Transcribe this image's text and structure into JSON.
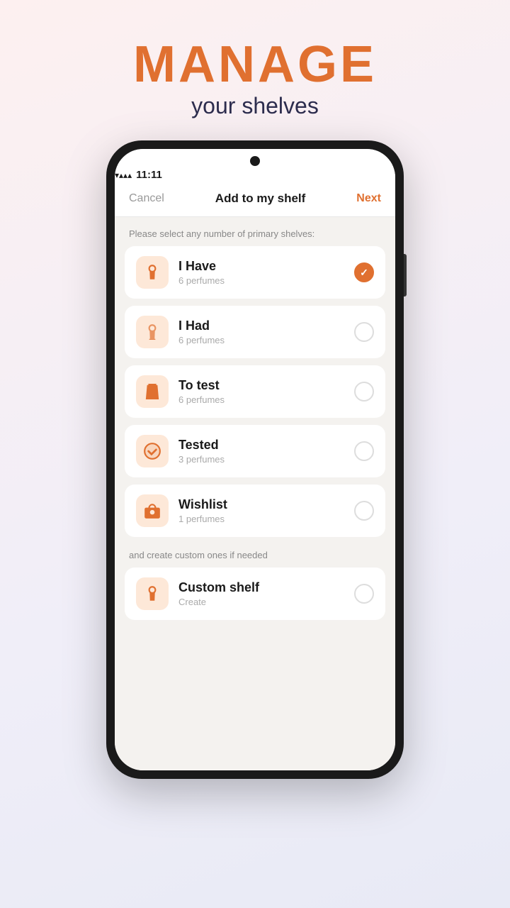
{
  "header": {
    "manage_label": "MANAGE",
    "subtitle_label": "your shelves"
  },
  "status_bar": {
    "time": "11:11"
  },
  "nav": {
    "cancel_label": "Cancel",
    "title_label": "Add to my shelf",
    "next_label": "Next"
  },
  "primary_section_label": "Please select any number of primary shelves:",
  "secondary_section_label": "and create custom ones if needed",
  "shelves": [
    {
      "id": "i-have",
      "name": "I Have",
      "count": "6 perfumes",
      "icon": "🧴",
      "checked": true
    },
    {
      "id": "i-had",
      "name": "I Had",
      "count": "6 perfumes",
      "icon": "🍶",
      "checked": false
    },
    {
      "id": "to-test",
      "name": "To test",
      "count": "6 perfumes",
      "icon": "🔖",
      "checked": false
    },
    {
      "id": "tested",
      "name": "Tested",
      "count": "3 perfumes",
      "icon": "✅",
      "checked": false
    },
    {
      "id": "wishlist",
      "name": "Wishlist",
      "count": "1 perfumes",
      "icon": "🎁",
      "checked": false
    }
  ],
  "custom_shelf": {
    "name": "Custom shelf",
    "subtitle": "Create",
    "icon": "🧴"
  }
}
